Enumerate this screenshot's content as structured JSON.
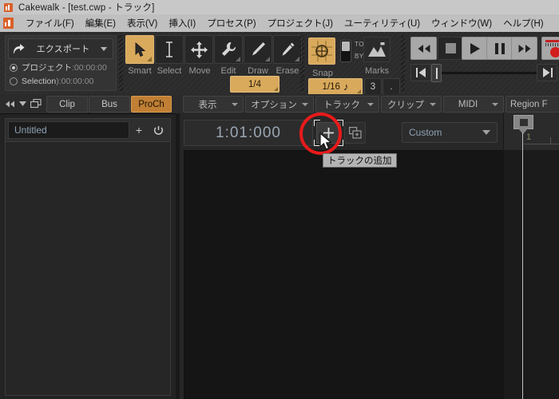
{
  "window": {
    "title": "Cakewalk - [test.cwp - トラック]",
    "app_icon": "cakewalk-logo-icon"
  },
  "menubar": {
    "items": [
      {
        "label": "ファイル(F)"
      },
      {
        "label": "編集(E)"
      },
      {
        "label": "表示(V)"
      },
      {
        "label": "挿入(I)"
      },
      {
        "label": "プロセス(P)"
      },
      {
        "label": "プロジェクト(J)"
      },
      {
        "label": "ユーティリティ(U)"
      },
      {
        "label": "ウィンドウ(W)"
      },
      {
        "label": "ヘルプ(H)"
      }
    ]
  },
  "toolbar": {
    "export": {
      "button_label": "エクスポート",
      "scope_project_label": "プロジェクト",
      "scope_project_time": ":00:00:00",
      "scope_selection_label": "Selection",
      "scope_selection_time": "):00:00:00",
      "selected_scope": "project"
    },
    "tools": [
      {
        "label": "Smart",
        "icon": "arrow-pointer-icon",
        "selected": true
      },
      {
        "label": "Select",
        "icon": "i-beam-icon",
        "selected": false
      },
      {
        "label": "Move",
        "icon": "move-arrows-icon",
        "selected": false
      },
      {
        "label": "Edit",
        "icon": "wrench-icon",
        "selected": false
      },
      {
        "label": "Draw",
        "icon": "pencil-icon",
        "selected": false
      },
      {
        "label": "Erase",
        "icon": "eraser-icon",
        "selected": false
      }
    ],
    "tool_resolution": "1/4",
    "snap": {
      "label": "Snap",
      "enabled": true,
      "to_label": "TO",
      "by_label": "BY",
      "value": "1/16",
      "note_icon": "eighth-note-icon",
      "count": "3",
      "dot": "."
    },
    "marks": {
      "label": "Marks",
      "icon": "mountain-flag-icon"
    },
    "transport": {
      "rewind": "rewind-icon",
      "stop": "stop-icon",
      "play": "play-icon",
      "pause": "pause-icon",
      "fast_forward": "fast-forward-icon",
      "record": "record-icon",
      "go_to_start": "go-to-start-icon",
      "go_to_end": "go-to-end-icon"
    }
  },
  "inspector_tabs": {
    "items": [
      {
        "label": "Clip",
        "active": false
      },
      {
        "label": "Bus",
        "active": false
      },
      {
        "label": "ProCh",
        "active": true
      }
    ],
    "collapse_icon": "double-chevron-left-icon",
    "dropdown_icon": "chevron-down-icon",
    "windows_icon": "cascade-windows-icon"
  },
  "view_menus": {
    "items": [
      {
        "label": "表示"
      },
      {
        "label": "オプション"
      },
      {
        "label": "トラック"
      },
      {
        "label": "クリップ"
      },
      {
        "label": "MIDI"
      }
    ],
    "region_fx_label": "Region F"
  },
  "bus_strip": {
    "name": "Untitled",
    "add_icon": "plus-icon",
    "power_icon": "power-icon"
  },
  "track_view": {
    "now_time": "1:01:000",
    "add_track_icon": "plus-icon",
    "duplicate_icon": "duplicate-track-icon",
    "track_preset": "Custom",
    "ruler_measure": "1"
  },
  "tooltip": {
    "text": "トラックの追加"
  },
  "highlight": {
    "annotation_color": "#e81a1a",
    "shape": "circle"
  },
  "colors": {
    "accent_amber": "#d9a95c",
    "accent_orange": "#c07f34",
    "titlebar_bg": "#c8c8c8",
    "menubar_bg": "#c0c0c0",
    "toolbar_bg": "#2b2b2b",
    "panel_bg": "#232323",
    "canvas_bg": "#151515",
    "text_blue": "#8fa3b5",
    "logo_orange": "#d9602a"
  }
}
